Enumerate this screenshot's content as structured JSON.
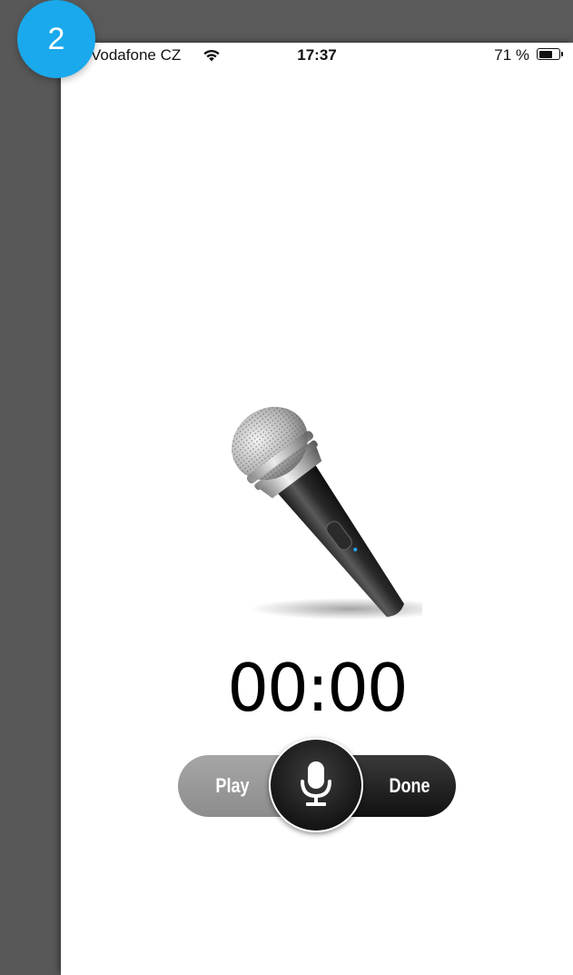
{
  "step_badge": "2",
  "status_bar": {
    "carrier": "Vodafone CZ",
    "time": "17:37",
    "battery_percent": "71 %",
    "battery_level": 0.71,
    "wifi_icon": "wifi-icon",
    "battery_icon": "battery-icon"
  },
  "recorder": {
    "microphone_image": "microphone-image",
    "timer": "00:00",
    "play_label": "Play",
    "done_label": "Done",
    "record_icon": "microphone-icon"
  },
  "colors": {
    "badge": "#1aa9ec",
    "play_button": "#999999",
    "done_button": "#1c1c1c",
    "record_button": "#222222"
  }
}
